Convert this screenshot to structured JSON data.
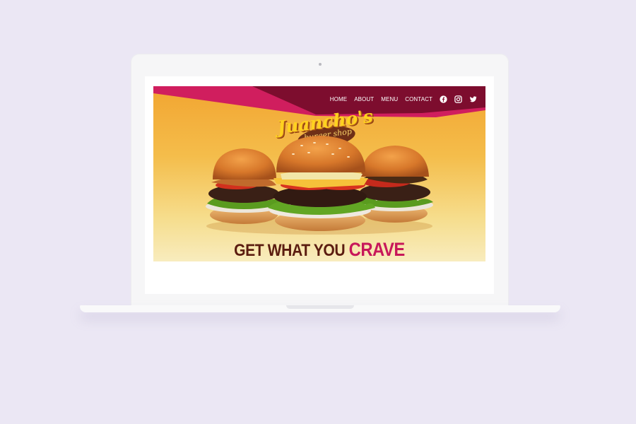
{
  "site": {
    "nav": {
      "home": "HOME",
      "about": "ABOUT",
      "menu": "MENU",
      "contact": "CONTACT"
    },
    "social": [
      "facebook-icon",
      "instagram-icon",
      "twitter-icon"
    ],
    "logo": {
      "name": "Juancho's",
      "subtitle": "burger shop"
    },
    "tagline": {
      "part1": "GET WHAT YOU",
      "part2": "CRAVE"
    }
  },
  "colors": {
    "page_background": "#ebe7f4",
    "band_pink": "#d01e5e",
    "band_maroon": "#7d0d2e",
    "hero_orange": "#f2a531",
    "tagline_brown": "#5b1d10",
    "tagline_accent": "#c7185a"
  }
}
